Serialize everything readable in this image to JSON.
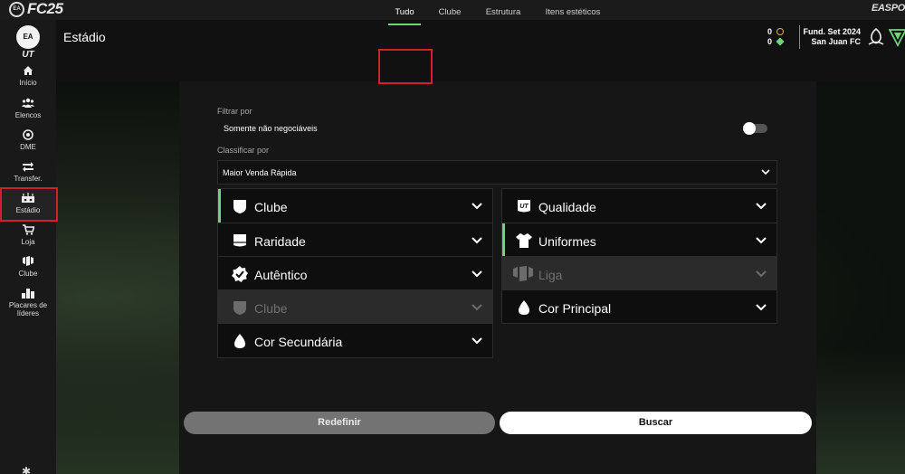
{
  "topbar": {
    "brand_ea": "EA",
    "brand_game": "FC25",
    "brand_right": "EASPO"
  },
  "sidebar": {
    "logo_text": "EA",
    "ut_label": "UT",
    "items": [
      {
        "label": "Início",
        "icon": "home-icon"
      },
      {
        "label": "Elencos",
        "icon": "squad-icon"
      },
      {
        "label": "DME",
        "icon": "ball-icon"
      },
      {
        "label": "Transfer.",
        "icon": "transfer-icon"
      },
      {
        "label": "Estádio",
        "icon": "stadium-icon",
        "active": true
      },
      {
        "label": "Loja",
        "icon": "cart-icon"
      },
      {
        "label": "Clube",
        "icon": "club-icon"
      },
      {
        "label": "Placares de líderes",
        "icon": "leaderboard-icon"
      }
    ]
  },
  "header": {
    "title": "Estádio",
    "coins": "0",
    "points": "0",
    "club_line1": "Fund. Set 2024",
    "club_line2": "San Juan FC"
  },
  "tabs": [
    {
      "label": "Tudo",
      "active": true
    },
    {
      "label": "Clube"
    },
    {
      "label": "Estrutura"
    },
    {
      "label": "Itens estéticos"
    }
  ],
  "filters": {
    "filter_by_label": "Filtrar por",
    "untradeable_label": "Somente não negociáveis",
    "untradeable_on": false,
    "sort_by_label": "Classificar por",
    "sort_value": "Maior Venda Rápida",
    "left_column": [
      {
        "label": "Clube",
        "icon": "shield-icon",
        "accent": true,
        "disabled": false
      },
      {
        "label": "Raridade",
        "icon": "card-rarity-icon",
        "accent": false,
        "disabled": false
      },
      {
        "label": "Autêntico",
        "icon": "verified-badge-icon",
        "accent": false,
        "disabled": false
      },
      {
        "label": "Clube",
        "icon": "shield-icon",
        "accent": false,
        "disabled": true
      },
      {
        "label": "Cor Secundária",
        "icon": "drop-icon",
        "accent": false,
        "disabled": false
      }
    ],
    "right_column": [
      {
        "label": "Qualidade",
        "icon": "ut-quality-icon",
        "accent": false,
        "disabled": false
      },
      {
        "label": "Uniformes",
        "icon": "shirt-icon",
        "accent": true,
        "disabled": false
      },
      {
        "label": "Liga",
        "icon": "league-icon",
        "accent": false,
        "disabled": true
      },
      {
        "label": "Cor Principal",
        "icon": "drop-icon",
        "accent": false,
        "disabled": false
      }
    ]
  },
  "actions": {
    "reset_label": "Redefinir",
    "search_label": "Buscar"
  },
  "colors": {
    "accent": "#6bd67a",
    "highlight": "#d0202a",
    "coin": "#d9b24a",
    "points": "#6bd67a"
  }
}
